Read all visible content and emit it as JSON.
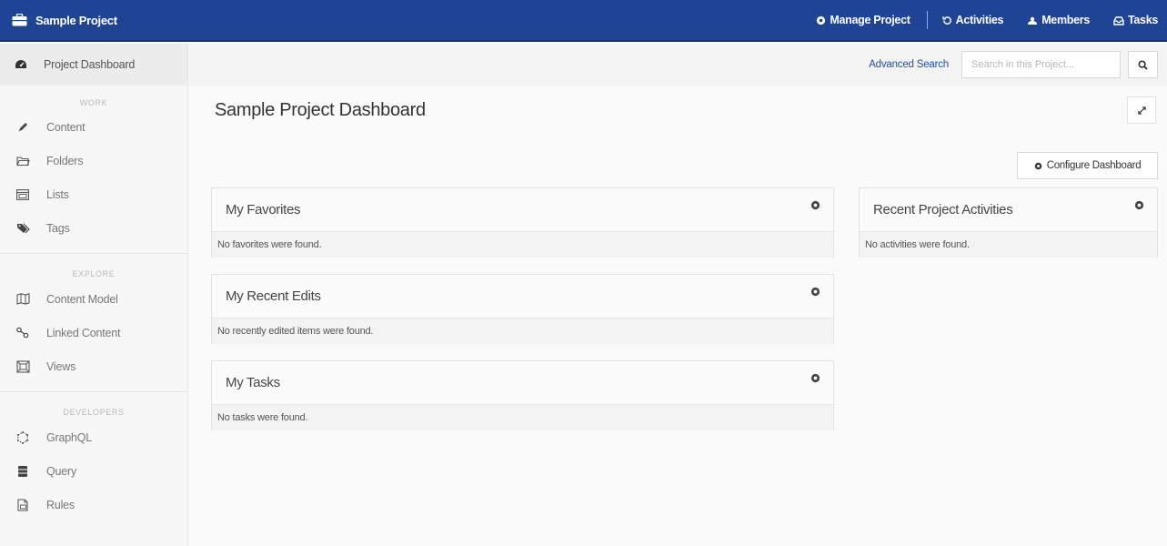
{
  "app": {
    "project_name": "Sample Project"
  },
  "topnav": {
    "manage": "Manage Project",
    "activities": "Activities",
    "members": "Members",
    "tasks": "Tasks"
  },
  "sidebar": {
    "dashboard": "Project Dashboard",
    "sections": [
      {
        "heading": "WORK",
        "items": [
          {
            "label": "Content",
            "icon": "pencil-icon"
          },
          {
            "label": "Folders",
            "icon": "folder-icon"
          },
          {
            "label": "Lists",
            "icon": "list-icon"
          },
          {
            "label": "Tags",
            "icon": "tags-icon"
          }
        ]
      },
      {
        "heading": "EXPLORE",
        "items": [
          {
            "label": "Content Model",
            "icon": "map-icon"
          },
          {
            "label": "Linked Content",
            "icon": "link-nodes-icon"
          },
          {
            "label": "Views",
            "icon": "views-icon"
          }
        ]
      },
      {
        "heading": "DEVELOPERS",
        "items": [
          {
            "label": "GraphQL",
            "icon": "graphql-icon"
          },
          {
            "label": "Query",
            "icon": "database-icon"
          },
          {
            "label": "Rules",
            "icon": "rules-icon"
          }
        ]
      }
    ]
  },
  "header": {
    "advanced_search": "Advanced Search",
    "search_placeholder": "Search in this Project..."
  },
  "main": {
    "title": "Sample Project Dashboard",
    "configure_label": "Configure Dashboard",
    "panels": [
      {
        "title": "My Favorites",
        "message": "No favorites were found."
      },
      {
        "title": "My Recent Edits",
        "message": "No recently edited items were found."
      },
      {
        "title": "My Tasks",
        "message": "No tasks were found."
      },
      {
        "title": "Recent Project Activities",
        "message": "No activities were found."
      }
    ]
  },
  "colors": {
    "topbar": "#1f4493",
    "link": "#23519c",
    "sidebar_bg": "#f7f7f7"
  }
}
